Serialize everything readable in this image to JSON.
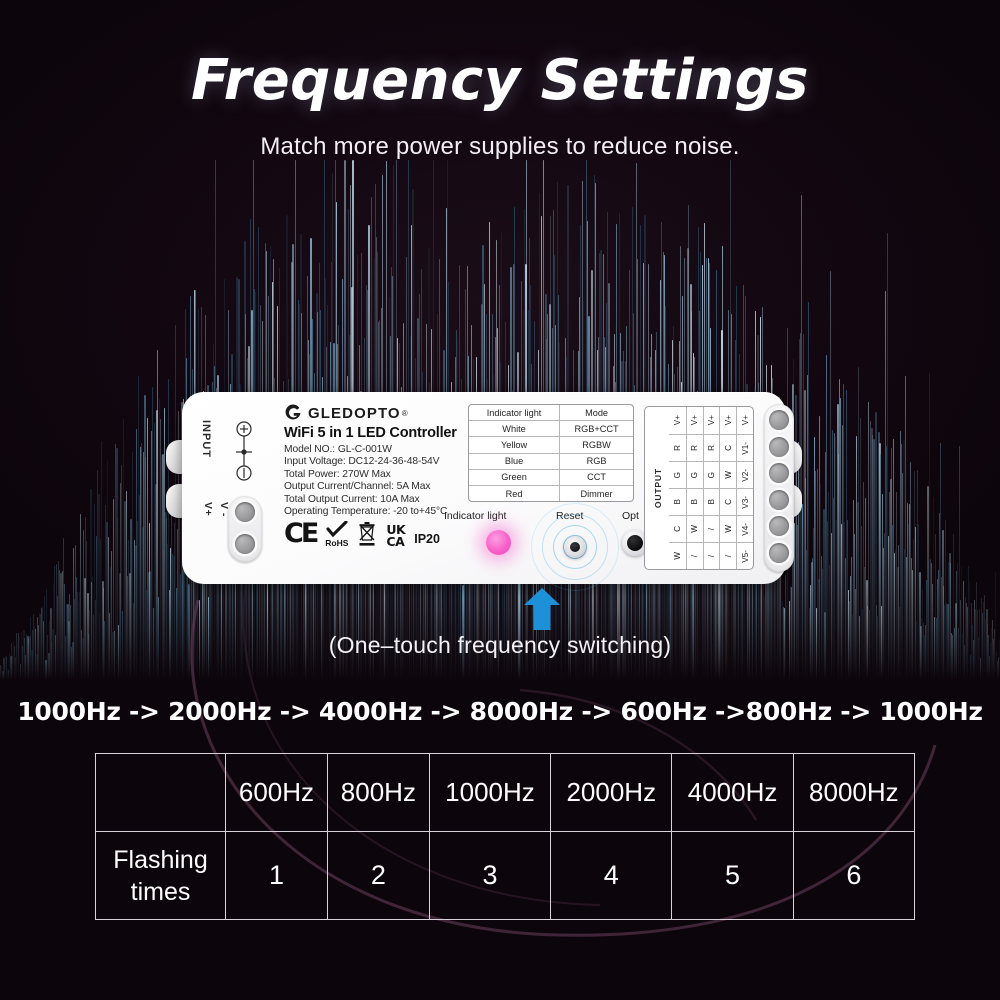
{
  "header": {
    "title": "Frequency Settings",
    "subtitle": "Match more power supplies to reduce noise."
  },
  "device": {
    "brand": "GLEDOPTO",
    "brand_reg": "®",
    "product_name": "WiFi 5 in 1 LED Controller",
    "input_label": "INPUT",
    "input_v_plus": "V+",
    "input_v_minus": "V -",
    "output_label": "OUTPUT",
    "specs": [
      "Model NO.:  GL-C-001W",
      "Input Voltage:  DC12-24-36-48-54V",
      "Total Power:  270W Max",
      "Output Current/Channel:  5A Max",
      "Total Output Current:  10A Max",
      "Operating Temperature:  -20 to+45°C"
    ],
    "certifications": {
      "ce": "CE",
      "rohs": "RoHS",
      "ukca_line1": "UK",
      "ukca_line2": "CA",
      "ip_rating": "IP20"
    },
    "indicator_table": {
      "headers": [
        "Indicator light",
        "Mode"
      ],
      "rows": [
        [
          "White",
          "RGB+CCT"
        ],
        [
          "Yellow",
          "RGBW"
        ],
        [
          "Blue",
          "RGB"
        ],
        [
          "Green",
          "CCT"
        ],
        [
          "Red",
          "Dimmer"
        ]
      ]
    },
    "controls": {
      "indicator_caption": "Indicator light",
      "reset_caption": "Reset",
      "opt_caption": "Opt",
      "indicator_color": "#f761c9"
    },
    "output_table": {
      "columns": [
        [
          "V+",
          "R",
          "G",
          "B",
          "C",
          "W"
        ],
        [
          "V+",
          "R",
          "G",
          "B",
          "W",
          "/"
        ],
        [
          "V+",
          "R",
          "G",
          "B",
          "/",
          "/"
        ],
        [
          "V+",
          "C",
          "W",
          "C",
          "W",
          "/"
        ],
        [
          "V+",
          "V1-",
          "V2-",
          "V3-",
          "V4-",
          "V5-"
        ]
      ]
    },
    "terminal_count_input": 2,
    "terminal_count_output": 6
  },
  "touch_caption": "(One–touch frequency switching)",
  "freq_sequence": "1000Hz -> 2000Hz -> 4000Hz -> 8000Hz -> 600Hz ->800Hz -> 1000Hz",
  "freq_table": {
    "headers": [
      "",
      "600Hz",
      "800Hz",
      "1000Hz",
      "2000Hz",
      "4000Hz",
      "8000Hz"
    ],
    "row_label": "Flashing\ntimes",
    "row_label_line1": "Flashing",
    "row_label_line2": "times",
    "flash_counts": [
      "1",
      "2",
      "3",
      "4",
      "5",
      "6"
    ]
  },
  "colors": {
    "background": "#120710",
    "accent_blue": "#1e90d8",
    "wave_blue": "#7fb6d8",
    "arc_purple": "#6b4060",
    "text_white": "#ffffff"
  },
  "icons": {
    "logo": "gledopto-logo-icon",
    "polarity": "polarity-icon",
    "arrow": "arrow-up-icon",
    "weee": "weee-bin-icon",
    "rohs_check": "checkmark-icon"
  }
}
